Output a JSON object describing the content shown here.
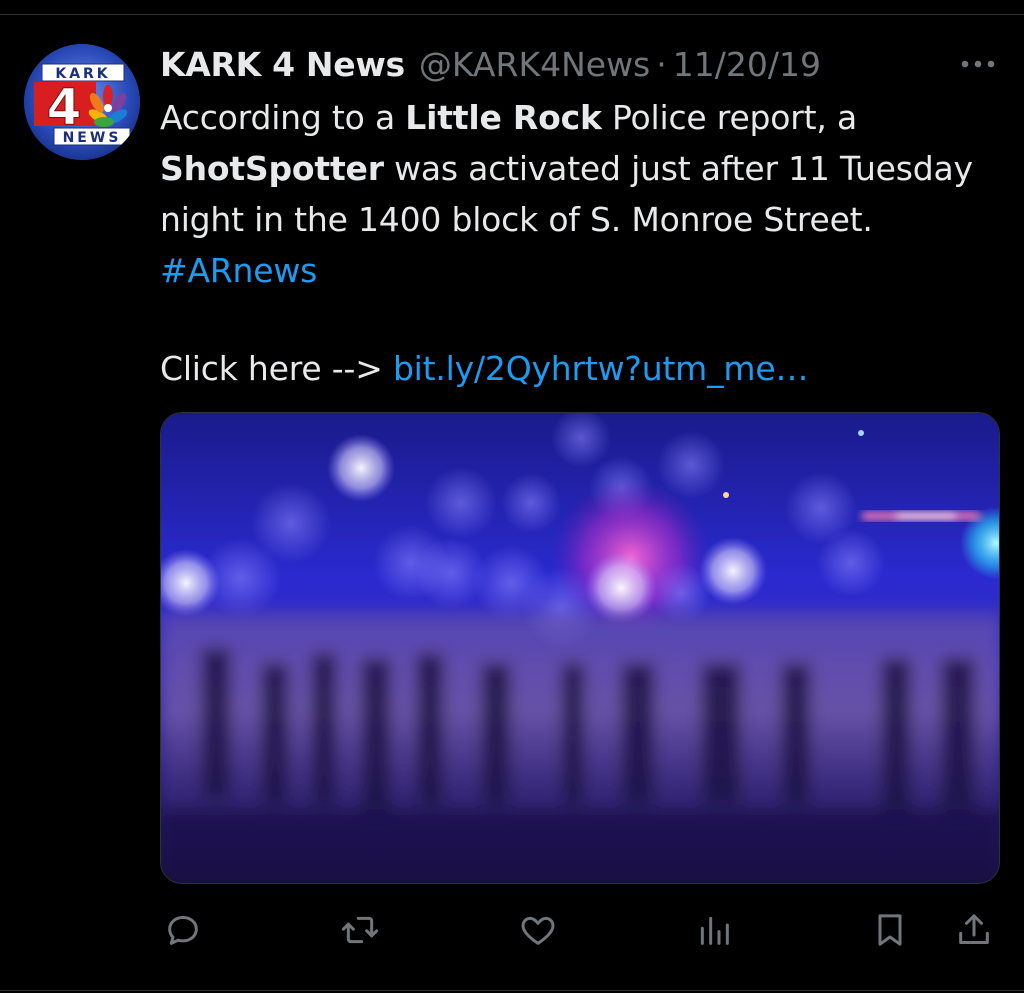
{
  "tweet": {
    "author": {
      "display_name": "KARK 4 News",
      "handle": "@KARK4News",
      "separator": "·",
      "date": "11/20/19",
      "avatar": {
        "top_text": "KARK",
        "number": "4",
        "bottom_text": "NEWS"
      }
    },
    "text_segments": [
      {
        "t": "According to a ",
        "style": "normal"
      },
      {
        "t": "Little Rock",
        "style": "bold"
      },
      {
        "t": " Police report, a ",
        "style": "normal"
      },
      {
        "t": "ShotSpotter",
        "style": "bold"
      },
      {
        "t": " was activated just after 11 Tuesday night in the 1400 block of S. Monroe Street. ",
        "style": "normal"
      },
      {
        "t": "#ARnews",
        "style": "link"
      }
    ],
    "click_prefix": "Click here --> ",
    "click_link": "bit.ly/2Qyhrtw?utm_me…",
    "media": {
      "kind": "blurred police lights over crime scene tape"
    }
  },
  "icons": {
    "more": "more-horizontal-icon",
    "reply": "reply-icon",
    "retweet": "retweet-icon",
    "like": "like-icon",
    "views": "views-icon",
    "bookmark": "bookmark-icon",
    "share": "share-icon"
  },
  "colors": {
    "background": "#000000",
    "text": "#e7e9ea",
    "muted": "#71767b",
    "link": "#1d9bf0",
    "icon": "#71767b",
    "divider": "#2f3336"
  }
}
